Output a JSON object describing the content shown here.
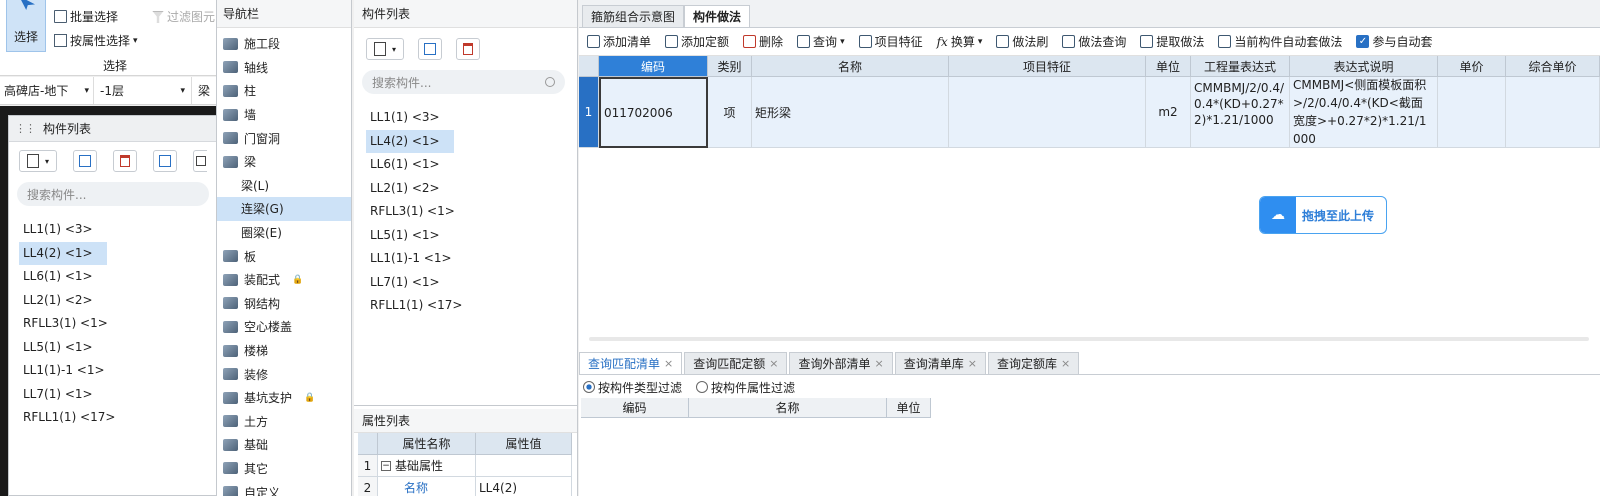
{
  "ribbon": {
    "select_label": "选择",
    "batch_select": "批量选择",
    "filter_graph": "过滤图元",
    "attr_select": "按属性选择",
    "group_label": "选择",
    "floor_dropdown": "高碑店-地下",
    "layer_dropdown": "-1层",
    "type_dropdown": "梁"
  },
  "left_panel": {
    "title": "构件列表",
    "search_placeholder": "搜索构件...",
    "items": [
      "LL1(1) <3>",
      "LL4(2) <1>",
      "LL6(1) <1>",
      "LL2(1) <2>",
      "RFLL3(1) <1>",
      "LL5(1) <1>",
      "LL1(1)-1 <1>",
      "LL7(1) <1>",
      "RFLL1(1) <17>"
    ]
  },
  "nav": {
    "title": "导航栏",
    "items": [
      "施工段",
      "轴线",
      "柱",
      "墙",
      "门窗洞",
      "梁",
      "梁(L)",
      "连梁(G)",
      "圈梁(E)",
      "板",
      "装配式",
      "钢结构",
      "空心楼盖",
      "楼梯",
      "装修",
      "基坑支护",
      "土方",
      "基础",
      "其它",
      "自定义"
    ]
  },
  "comp_list": {
    "title": "构件列表",
    "search_placeholder": "搜索构件...",
    "items": [
      "LL1(1) <3>",
      "LL4(2) <1>",
      "LL6(1) <1>",
      "LL2(1) <2>",
      "RFLL3(1) <1>",
      "LL5(1) <1>",
      "LL1(1)-1 <1>",
      "LL7(1) <1>",
      "RFLL1(1) <17>"
    ]
  },
  "props": {
    "title": "属性列表",
    "col_name": "属性名称",
    "col_value": "属性值",
    "rows": [
      {
        "num": "1",
        "name": "基础属性",
        "value": ""
      },
      {
        "num": "2",
        "name": "名称",
        "value": "LL4(2)"
      }
    ]
  },
  "right": {
    "tabs": [
      "箍筋组合示意图",
      "构件做法"
    ],
    "toolbar": [
      "添加清单",
      "添加定额",
      "删除",
      "查询",
      "项目特征",
      "换算",
      "做法刷",
      "做法查询",
      "提取做法",
      "当前构件自动套做法",
      "参与自动套"
    ],
    "columns": [
      "编码",
      "类别",
      "名称",
      "项目特征",
      "单位",
      "工程量表达式",
      "表达式说明",
      "单价",
      "综合单价"
    ],
    "row": {
      "num": "1",
      "code": "011702006",
      "type": "项",
      "name": "矩形梁",
      "feature": "",
      "unit": "m2",
      "expr": "CMMBMJ/2/0.4/0.4*(KD+0.27*2)*1.21/1000",
      "expr_desc": "CMMBMJ<侧面模板面积>/2/0.4/0.4*(KD<截面宽度>+0.27*2)*1.21/1000",
      "price": "",
      "total_price": ""
    },
    "upload_label": "拖拽至此上传",
    "bottom_tabs": [
      "查询匹配清单",
      "查询匹配定额",
      "查询外部清单",
      "查询清单库",
      "查询定额库"
    ],
    "filter_options": [
      "按构件类型过滤",
      "按构件属性过滤"
    ],
    "bottom_columns": [
      "编码",
      "名称",
      "单位"
    ]
  },
  "colors": {
    "accent": "#2870c4",
    "selected": "#cde2f7",
    "header": "#dce6f0"
  }
}
